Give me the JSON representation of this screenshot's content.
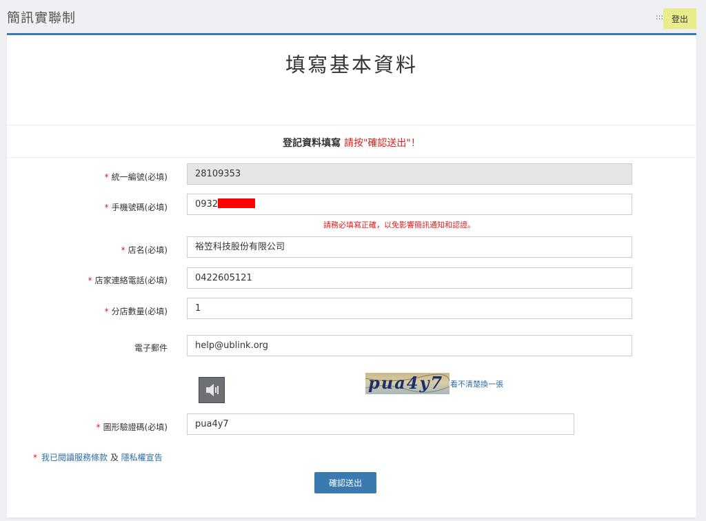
{
  "header": {
    "app_title": "簡訊實聯制",
    "menu_glyph": ":::",
    "logout_label": "登出"
  },
  "main": {
    "page_title": "填寫基本資料",
    "section_heading": {
      "text": "登記資料填寫 ",
      "emphasis": "請按\"確認送出\"！"
    }
  },
  "form": {
    "required_marker": "*",
    "tax_id": {
      "label": "統一編號(必填)",
      "value": "28109353"
    },
    "mobile": {
      "label": "手機號碼(必填)",
      "value": "0932",
      "hint": "請務必填寫正確，以免影響簡訊通知和認證。"
    },
    "store_name": {
      "label": "店名(必填)",
      "value": "裕笠科技股份有限公司"
    },
    "store_phone": {
      "label": "店家連絡電話(必填)",
      "value": "0422605121"
    },
    "branch_count": {
      "label": "分店數量(必填)",
      "value": "1"
    },
    "email": {
      "label": "電子郵件",
      "value": "help@ublink.org"
    },
    "captcha": {
      "image_text": "pua4y7",
      "refresh_label": "看不清楚換一張",
      "label": "圖形驗證碼(必填)",
      "value": "pua4y7"
    },
    "terms": {
      "text_before": "我已閱讀",
      "tos_link": "服務條款",
      "conjunction": " 及 ",
      "privacy_link": "隱私權宣告"
    },
    "submit_label": "確認送出"
  },
  "colors": {
    "accent": "#3b7ab0",
    "required": "#d9201f",
    "logout_bg": "#e9ec8a"
  },
  "icons": {
    "audio": "speaker-icon"
  }
}
